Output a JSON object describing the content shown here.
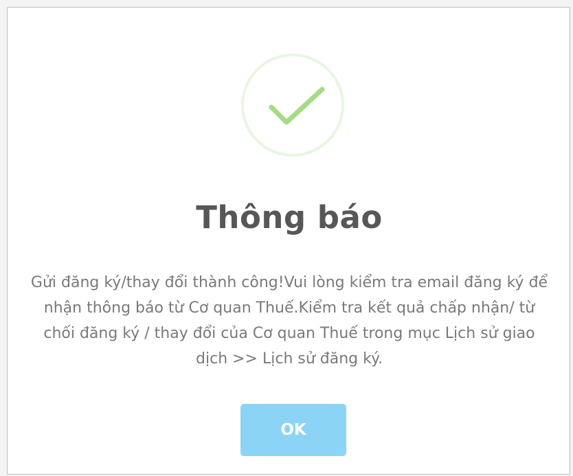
{
  "dialog": {
    "icon": "success-checkmark-icon",
    "title": "Thông báo",
    "message": "Gửi đăng ký/thay đổi thành công!Vui lòng kiểm tra email đăng ký để nhận thông báo từ Cơ quan Thuế.Kiểm tra kết quả chấp nhận/ từ chối đăng ký / thay đổi của Cơ quan Thuế trong mục Lịch sử giao dịch >> Lịch sử đăng ký.",
    "ok_label": "OK"
  },
  "colors": {
    "success_green": "#a5dc86",
    "button_blue": "#8cd4f5",
    "title_text": "#575757",
    "message_text": "#797979"
  }
}
